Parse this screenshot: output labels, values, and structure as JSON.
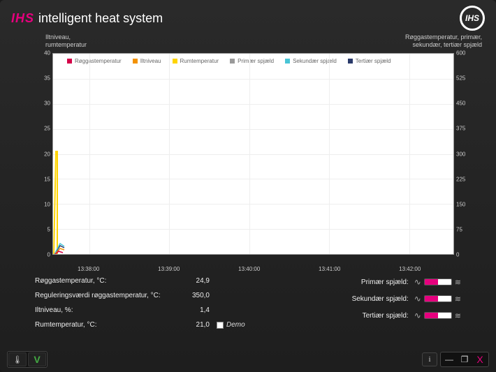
{
  "brand": {
    "short": "IHS",
    "title": "intelligent heat system",
    "logo": "IHS"
  },
  "axis": {
    "left_label_1": "Iltniveau,",
    "left_label_2": "rumtemperatur",
    "right_label_1": "Røggastemperatur, primær,",
    "right_label_2": "sekundær, tertiær spjæld",
    "left_ticks": [
      "40",
      "35",
      "30",
      "25",
      "20",
      "15",
      "10",
      "5",
      "0"
    ],
    "right_ticks": [
      "600",
      "525",
      "450",
      "375",
      "300",
      "225",
      "150",
      "75",
      "0"
    ],
    "x_ticks": [
      "13:38:00",
      "13:39:00",
      "13:40:00",
      "13:41:00",
      "13:42:00"
    ]
  },
  "legend": {
    "items": [
      {
        "label": "Røggastemperatur",
        "color": "#d40048"
      },
      {
        "label": "Iltniveau",
        "color": "#f39200"
      },
      {
        "label": "Rumtemperatur",
        "color": "#ffd400"
      },
      {
        "label": "Primær spjæld",
        "color": "#9a9a9a"
      },
      {
        "label": "Sekundær spjæld",
        "color": "#49c5d6"
      },
      {
        "label": "Tertiær spjæld",
        "color": "#2a3a6a"
      }
    ]
  },
  "chart_data": {
    "type": "line",
    "x": [
      "13:38:00",
      "13:39:00",
      "13:40:00",
      "13:41:00",
      "13:42:00"
    ],
    "left_axis": {
      "label": "Iltniveau, rumtemperatur",
      "range": [
        0,
        40
      ]
    },
    "right_axis": {
      "label": "Røggastemperatur, primær, sekundær, tertiær spjæld",
      "range": [
        0,
        600
      ]
    },
    "series": [
      {
        "name": "Røggastemperatur",
        "axis": "right",
        "values": [
          25,
          null,
          null,
          null,
          null
        ]
      },
      {
        "name": "Iltniveau",
        "axis": "left",
        "values": [
          1.4,
          null,
          null,
          null,
          null
        ]
      },
      {
        "name": "Rumtemperatur",
        "axis": "left",
        "values": [
          21,
          null,
          null,
          null,
          null
        ]
      },
      {
        "name": "Primær spjæld",
        "axis": "right",
        "values": [
          30,
          null,
          null,
          null,
          null
        ]
      },
      {
        "name": "Sekundær spjæld",
        "axis": "right",
        "values": [
          30,
          null,
          null,
          null,
          null
        ]
      },
      {
        "name": "Tertiær spjæld",
        "axis": "right",
        "values": [
          30,
          null,
          null,
          null,
          null
        ]
      }
    ],
    "note": "Only initial samples visible at left edge; rumtemperatur shows brief spike to ~21."
  },
  "readings": {
    "roeg_label": "Røggastemperatur, °C:",
    "roeg_val": "24,9",
    "reg_label": "Reguleringsværdi røggastemperatur, °C:",
    "reg_val": "350,0",
    "ilt_label": "Iltniveau, %:",
    "ilt_val": "1,4",
    "rum_label": "Rumtemperatur, °C:",
    "rum_val": "21,0",
    "demo_label": "Demo",
    "prim_label": "Primær spjæld:",
    "sek_label": "Sekundær spjæld:",
    "ter_label": "Tertiær spjæld:"
  },
  "footer": {
    "info": "i",
    "min": "—",
    "max": "❐",
    "close": "X",
    "check": "V"
  }
}
